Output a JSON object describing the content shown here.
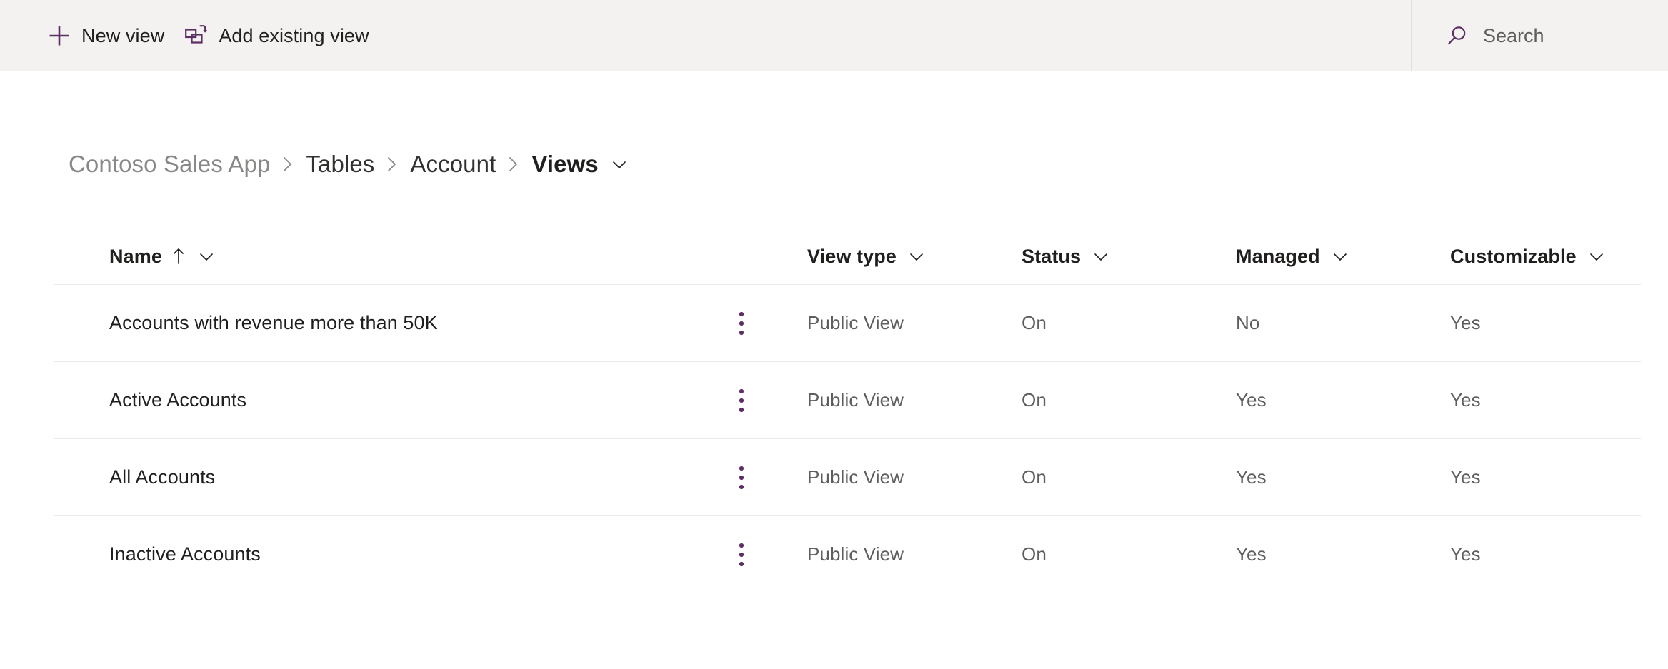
{
  "commandbar": {
    "buttons": [
      {
        "label": "New view",
        "icon": "plus-icon"
      },
      {
        "label": "Add existing view",
        "icon": "add-existing-icon"
      }
    ],
    "search": {
      "placeholder": "Search",
      "icon": "search-icon"
    }
  },
  "breadcrumb": {
    "separator": "›",
    "items": [
      {
        "label": "Contoso Sales App",
        "state": "muted"
      },
      {
        "label": "Tables",
        "state": "normal"
      },
      {
        "label": "Account",
        "state": "normal"
      },
      {
        "label": "Views",
        "state": "current"
      }
    ]
  },
  "table": {
    "columns": [
      {
        "key": "name",
        "label": "Name",
        "sorted": "ascending",
        "sort_glyph": "↑"
      },
      {
        "key": "viewtype",
        "label": "View type"
      },
      {
        "key": "status",
        "label": "Status"
      },
      {
        "key": "managed",
        "label": "Managed"
      },
      {
        "key": "customizable",
        "label": "Customizable"
      }
    ],
    "more_options_label": "⋮",
    "rows": [
      {
        "name": "Accounts with revenue more than 50K",
        "viewtype": "Public View",
        "status": "On",
        "managed": "No",
        "customizable": "Yes"
      },
      {
        "name": "Active Accounts",
        "viewtype": "Public View",
        "status": "On",
        "managed": "Yes",
        "customizable": "Yes"
      },
      {
        "name": "All Accounts",
        "viewtype": "Public View",
        "status": "On",
        "managed": "Yes",
        "customizable": "Yes"
      },
      {
        "name": "Inactive Accounts",
        "viewtype": "Public View",
        "status": "On",
        "managed": "Yes",
        "customizable": "Yes"
      }
    ]
  },
  "colors": {
    "accent_purple": "#5c2e63",
    "commandbar_bg": "#f3f2f1",
    "text_primary": "#201f1e",
    "text_secondary": "#605e5c",
    "text_muted": "#8a8886",
    "divider": "#edebe9"
  }
}
